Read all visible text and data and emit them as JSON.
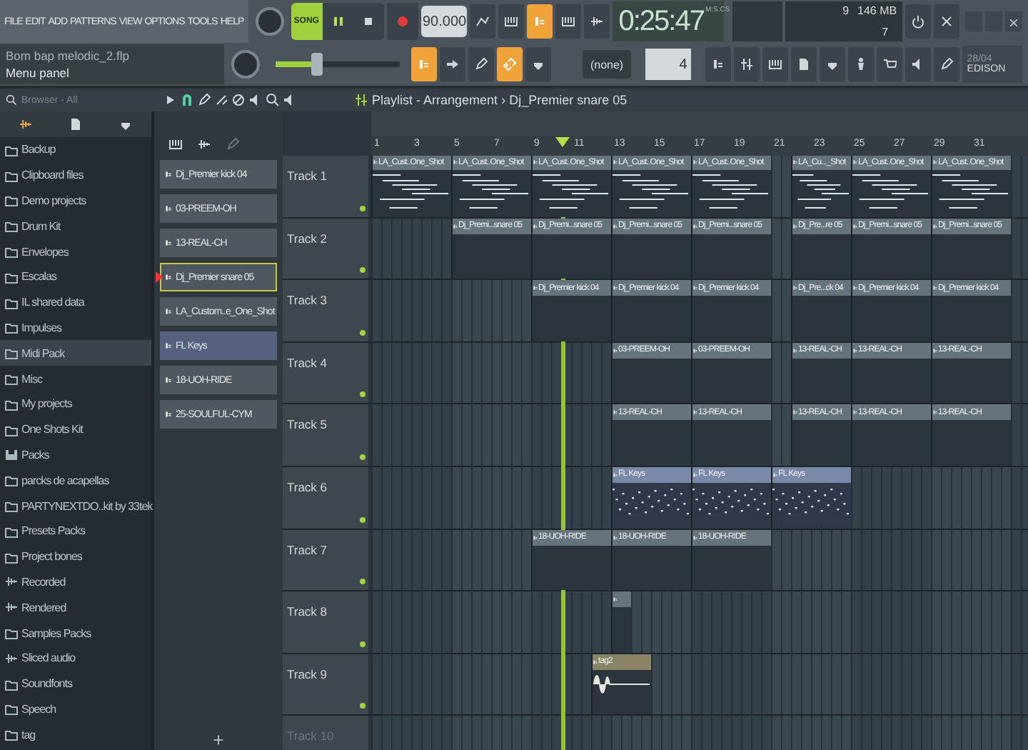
{
  "menu": [
    "FILE",
    "EDIT",
    "ADD",
    "PATTERNS",
    "VIEW",
    "OPTIONS",
    "TOOLS",
    "HELP"
  ],
  "info": {
    "file": "Bom bap melodic_2.flp",
    "hint": "Menu panel"
  },
  "transport": {
    "mode": "SONG",
    "tempo": "90.000",
    "time": "0:25:47",
    "time_unit": "M:S:CS"
  },
  "monitor": {
    "voices": "9",
    "memory": "146 MB",
    "cpu": "7"
  },
  "master_pitch": {
    "level": 0.3
  },
  "toolbar": {
    "pattern": "(none)",
    "step": "4",
    "news_date": "28/04",
    "news_text": "EDISON"
  },
  "browser": {
    "title": "Browser - All",
    "items": [
      {
        "label": "Backup",
        "kind": "folder",
        "selected": false
      },
      {
        "label": "Clipboard files",
        "kind": "folder",
        "selected": false
      },
      {
        "label": "Demo projects",
        "kind": "folder",
        "selected": false
      },
      {
        "label": "Drum Kit",
        "kind": "folder",
        "selected": false
      },
      {
        "label": "Envelopes",
        "kind": "folder",
        "selected": false
      },
      {
        "label": "Escalas",
        "kind": "folder",
        "selected": false
      },
      {
        "label": "IL shared data",
        "kind": "folder",
        "selected": false
      },
      {
        "label": "Impulses",
        "kind": "folder",
        "selected": false
      },
      {
        "label": "Midi Pack",
        "kind": "folder",
        "selected": true
      },
      {
        "label": "Misc",
        "kind": "folder",
        "selected": false
      },
      {
        "label": "My projects",
        "kind": "folder",
        "selected": false
      },
      {
        "label": "One Shots Kit",
        "kind": "folder",
        "selected": false
      },
      {
        "label": "Packs",
        "kind": "packs",
        "selected": false
      },
      {
        "label": "parcks de acapellas",
        "kind": "folder",
        "selected": false
      },
      {
        "label": "PARTYNEXTDO..kit by 33tek",
        "kind": "folder",
        "selected": false
      },
      {
        "label": "Presets Packs",
        "kind": "folder",
        "selected": false
      },
      {
        "label": "Project bones",
        "kind": "folder",
        "selected": false
      },
      {
        "label": "Recorded",
        "kind": "audio",
        "selected": false
      },
      {
        "label": "Rendered",
        "kind": "audio",
        "selected": false
      },
      {
        "label": "Samples Packs",
        "kind": "folder",
        "selected": false
      },
      {
        "label": "Sliced audio",
        "kind": "audio",
        "selected": false
      },
      {
        "label": "Soundfonts",
        "kind": "folder",
        "selected": false
      },
      {
        "label": "Speech",
        "kind": "folder",
        "selected": false
      },
      {
        "label": "tag",
        "kind": "folder",
        "selected": false
      }
    ]
  },
  "playlist": {
    "title": "Playlist - Arrangement",
    "separator": "›",
    "pattern": "Dj_Premier snare 05",
    "ruler": [
      "1",
      "3",
      "5",
      "7",
      "9",
      "11",
      "13",
      "15",
      "17",
      "19",
      "21",
      "23",
      "25",
      "27",
      "29",
      "31"
    ],
    "channels": [
      {
        "name": "Dj_Premier kick 04",
        "kind": "sampler",
        "selected": false
      },
      {
        "name": "03-PREEM-OH",
        "kind": "sampler",
        "selected": false
      },
      {
        "name": "13-REAL-CH",
        "kind": "sampler",
        "selected": false
      },
      {
        "name": "Dj_Premier snare 05",
        "kind": "sampler",
        "selected": true
      },
      {
        "name": "LA_Custom..e_One_Shot",
        "kind": "sampler",
        "selected": false
      },
      {
        "name": "FL Keys",
        "kind": "instrument",
        "selected": false
      },
      {
        "name": "18-UOH-RIDE",
        "kind": "sampler",
        "selected": false
      },
      {
        "name": "25-SOULFUL-CYM",
        "kind": "sampler",
        "selected": false
      }
    ],
    "tracks": [
      {
        "name": "Track 1",
        "clips": [
          {
            "label": "LA_Cust..One_Shot",
            "kind": "drums"
          },
          {
            "label": "LA_Cust..One_Shot",
            "kind": "drums"
          },
          {
            "label": "LA_Cust..One_Shot",
            "kind": "drums"
          },
          {
            "label": "LA_Cust..One_Shot",
            "kind": "drums"
          },
          {
            "label": "LA_Cust..One_Shot",
            "kind": "drums"
          },
          {
            "label": "LA_Cu..._Shot",
            "kind": "drums"
          },
          {
            "label": "LA_Cust..One_Shot",
            "kind": "drums"
          },
          {
            "label": "LA_Cust..One_Shot",
            "kind": "drums"
          }
        ]
      },
      {
        "name": "Track 2",
        "clips": [
          {
            "label": "Dj_Premi...snare 05",
            "kind": "pattern"
          },
          {
            "label": "Dj_Premi...snare 05",
            "kind": "pattern"
          },
          {
            "label": "Dj_Premi...snare 05",
            "kind": "pattern"
          },
          {
            "label": "Dj_Premi...snare 05",
            "kind": "pattern"
          },
          {
            "label": "Dj_Pre...re 05",
            "kind": "pattern"
          },
          {
            "label": "Dj_Premi...snare 05",
            "kind": "pattern"
          },
          {
            "label": "Dj_Premi...snare 05",
            "kind": "pattern"
          }
        ]
      },
      {
        "name": "Track 3",
        "clips": [
          {
            "label": "Dj_Premier kick 04",
            "kind": "pattern"
          },
          {
            "label": "Dj_Premier kick 04",
            "kind": "pattern"
          },
          {
            "label": "Dj_Premier kick 04",
            "kind": "pattern"
          },
          {
            "label": "Dj_Pre...ck 04",
            "kind": "pattern"
          },
          {
            "label": "Dj_Premier kick 04",
            "kind": "pattern"
          },
          {
            "label": "Dj_Premier kick 04",
            "kind": "pattern"
          }
        ]
      },
      {
        "name": "Track 4",
        "clips": [
          {
            "label": "03-PREEM-OH",
            "kind": "pattern"
          },
          {
            "label": "03-PREEM-OH",
            "kind": "pattern"
          },
          {
            "label": "13-REAL-CH",
            "kind": "pattern"
          },
          {
            "label": "13-REAL-CH",
            "kind": "pattern"
          },
          {
            "label": "13-REAL-CH",
            "kind": "pattern"
          }
        ]
      },
      {
        "name": "Track 5",
        "clips": [
          {
            "label": "13-REAL-CH",
            "kind": "pattern"
          },
          {
            "label": "13-REAL-CH",
            "kind": "pattern"
          },
          {
            "label": "13-REAL-CH",
            "kind": "pattern"
          },
          {
            "label": "13-REAL-CH",
            "kind": "pattern"
          },
          {
            "label": "13-REAL-CH",
            "kind": "pattern"
          }
        ]
      },
      {
        "name": "Track 6",
        "clips": [
          {
            "label": "FL Keys",
            "kind": "keys"
          },
          {
            "label": "FL Keys",
            "kind": "keys"
          },
          {
            "label": "FL Keys",
            "kind": "keys"
          }
        ]
      },
      {
        "name": "Track 7",
        "clips": [
          {
            "label": "18-UOH-RIDE",
            "kind": "pattern"
          },
          {
            "label": "18-UOH-RIDE",
            "kind": "pattern"
          },
          {
            "label": "18-UOH-RIDE",
            "kind": "pattern"
          }
        ]
      },
      {
        "name": "Track 8",
        "clips": [
          {
            "kind": "pattern"
          }
        ]
      },
      {
        "name": "Track 9",
        "clips": [
          {
            "label": "tag2",
            "kind": "audio"
          }
        ]
      },
      {
        "name": "Track 10"
      }
    ]
  }
}
